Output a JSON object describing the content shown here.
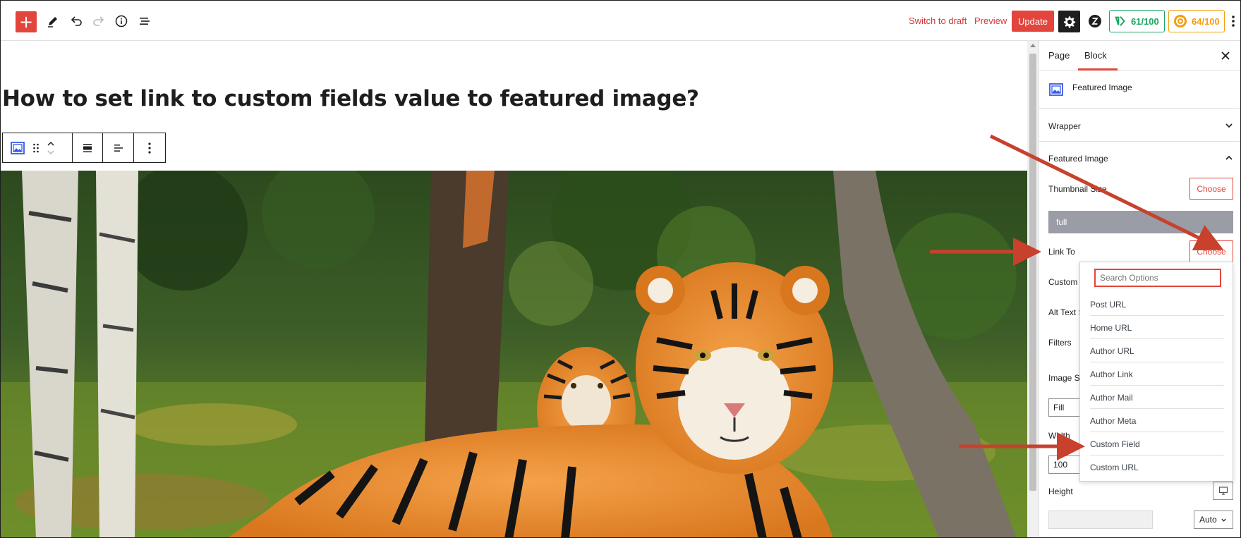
{
  "toolbar": {
    "add_label": "+",
    "switch_to_draft": "Switch to draft",
    "preview": "Preview",
    "update": "Update",
    "score_seo": "61/100",
    "score_readability": "64/100",
    "icons": [
      "pencil-icon",
      "undo-icon",
      "redo-icon",
      "info-icon",
      "list-view-icon",
      "gear-icon",
      "plugin-icon",
      "more-options-icon"
    ]
  },
  "editor": {
    "post_title": "How to set link to custom fields value to featured image?",
    "block_toolbar_icons": [
      "featured-image-icon",
      "drag-handle-icon",
      "move-up-icon",
      "move-down-icon",
      "align-wide-icon",
      "justify-left-icon",
      "more-options-icon"
    ]
  },
  "sidebar": {
    "tabs": [
      {
        "label": "Page",
        "active": false
      },
      {
        "label": "Block",
        "active": true
      }
    ],
    "block_name": "Featured Image",
    "panels": {
      "wrapper": "Wrapper",
      "featured_image": "Featured Image"
    },
    "controls": {
      "thumbnail_size_label": "Thumbnail Size",
      "thumbnail_size_value": "full",
      "link_to_label": "Link To",
      "custom_label": "Custom",
      "alt_text_label": "Alt Text S",
      "filters_label": "Filters",
      "image_size_label": "Image S",
      "fill_value": "Fill",
      "width_label": "Width",
      "width_value": "100",
      "height_label": "Height",
      "height_unit": "Auto",
      "choose_label": "Choose"
    }
  },
  "dropdown": {
    "search_placeholder": "Search Options",
    "options": [
      "Post URL",
      "Home URL",
      "Author URL",
      "Author Link",
      "Author Mail",
      "Author Meta",
      "Custom Field",
      "Custom URL"
    ]
  },
  "colors": {
    "accent": "#e2453c",
    "seo_green": "#1aa760",
    "readability_orange": "#f59e0b",
    "annotation_arrow": "#c7412d"
  }
}
